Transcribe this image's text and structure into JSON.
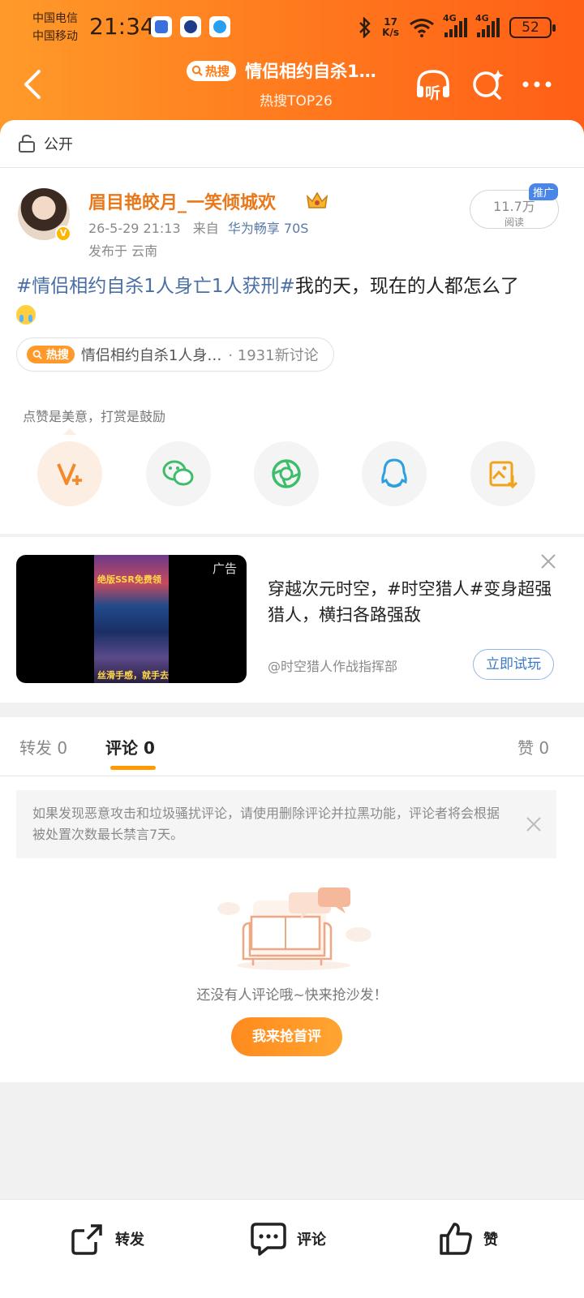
{
  "status_bar": {
    "carrier1": "中国电信",
    "carrier2": "中国移动",
    "time": "21:34",
    "net_speed_value": "17",
    "net_speed_unit": "K/s",
    "signal1": "4G",
    "signal2": "4G",
    "battery": "52"
  },
  "nav": {
    "hot_label": "热搜",
    "title": "情侣相约自杀1…",
    "subtitle": "热搜TOP26",
    "listen_label": "听"
  },
  "post": {
    "visibility": "公开",
    "author": "眉目艳皎月_一笑倾城欢",
    "time": "26-5-29 21:13",
    "from_label": "来自",
    "device": "华为畅享 70S",
    "location": "发布于 云南",
    "reads_value": "11.7万",
    "reads_label": "阅读",
    "promo_label": "推广",
    "hashtag": "#情侣相约自杀1人身亡1人获刑#",
    "text": "我的天，现在的人都怎么了",
    "topic_chip": "热搜",
    "topic_title": "情侣相约自杀1人身…",
    "topic_count": "· 1931新讨论",
    "reward_tip": "点赞是美意，打赏是鼓励"
  },
  "share_icons": [
    "vplus-icon",
    "wechat-icon",
    "moments-icon",
    "qq-icon",
    "save-image-icon"
  ],
  "ad": {
    "label": "广告",
    "text": "穿越次元时空，#时空猎人#变身超强猎人，横扫各路强敌",
    "source": "@时空猎人作战指挥部",
    "button": "立即试玩",
    "art_top": "绝版SSR免费领",
    "art_bottom": "丝滑手感，就手去战"
  },
  "tabs": {
    "repost": "转发 0",
    "comments": "评论 0",
    "likes": "赞 0"
  },
  "notice": "如果发现恶意攻击和垃圾骚扰评论，请使用删除评论并拉黑功能，评论者将会根据被处置次数最长禁言7天。",
  "empty_state": {
    "text": "还没有人评论哦~快来抢沙发！",
    "button": "我来抢首评"
  },
  "bottom_bar": {
    "repost": "转发",
    "comment": "评论",
    "like": "赞"
  },
  "colors": {
    "header_start": "#ff9a2a",
    "header_end": "#ff5f16",
    "author": "#e8781a",
    "hashtag": "#4a6fa5",
    "accent": "#ff9a00"
  }
}
